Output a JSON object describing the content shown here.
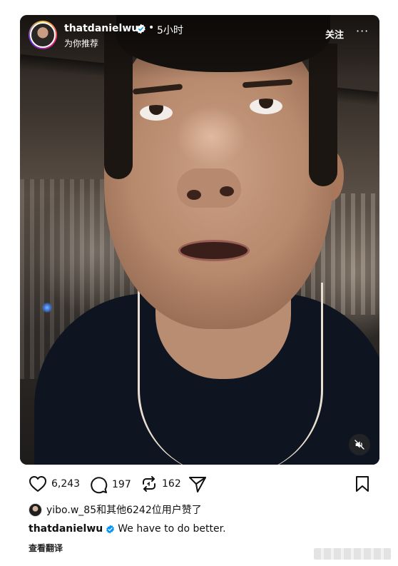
{
  "post": {
    "author": {
      "username": "thatdanielwu",
      "verified": true,
      "avatar_icon": "profile-avatar"
    },
    "separator": "•",
    "timestamp": "5小时",
    "subtitle": "为你推荐",
    "follow_label": "关注",
    "more_icon": "more-horizontal-icon",
    "more_label": "···",
    "media": {
      "type": "video",
      "muted": true,
      "mute_icon": "speaker-muted-icon"
    },
    "actions": {
      "like_count": "6,243",
      "comment_count": "197",
      "repost_count": "162",
      "like_icon": "heart-icon",
      "comment_icon": "comment-bubble-icon",
      "repost_icon": "repost-icon",
      "share_icon": "send-icon",
      "save_icon": "bookmark-icon"
    },
    "likes_line": {
      "user": "yibo.w_85",
      "text": "和其他6242位用户赞了"
    },
    "caption": {
      "username": "thatdanielwu",
      "text": "We have to do better."
    },
    "translate_label": "查看翻译"
  },
  "colors": {
    "verified_blue": "#0095f6",
    "text": "#111111"
  }
}
